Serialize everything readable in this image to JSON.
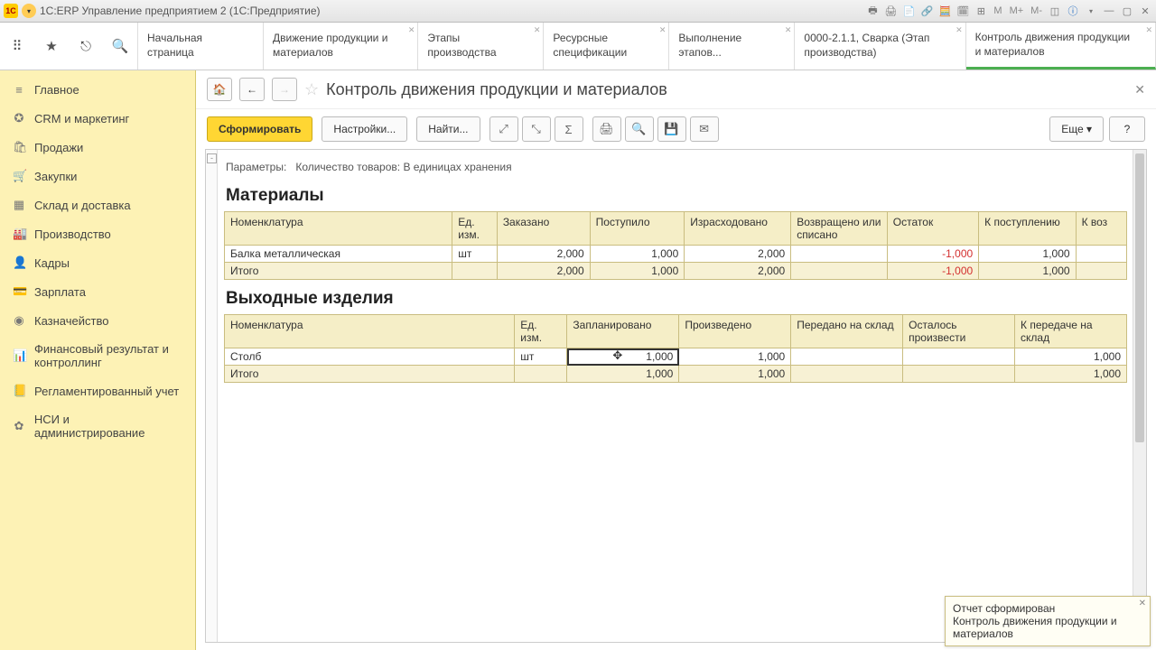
{
  "window": {
    "title": "1С:ERP Управление предприятием 2  (1С:Предприятие)"
  },
  "title_icons_text": [
    "M",
    "M+",
    "M-"
  ],
  "tabs": [
    {
      "label": "Начальная страница",
      "closable": false
    },
    {
      "label": "Движение продукции и материалов",
      "closable": true
    },
    {
      "label": "Этапы производства",
      "closable": true
    },
    {
      "label": "Ресурсные спецификации",
      "closable": true
    },
    {
      "label": "Выполнение этапов...",
      "closable": true
    },
    {
      "label": "0000-2.1.1, Сварка (Этап производства)",
      "closable": true
    },
    {
      "label": "Контроль движения продукции и материалов",
      "closable": true,
      "active": true
    }
  ],
  "sidebar": [
    {
      "icon": "≡",
      "label": "Главное"
    },
    {
      "icon": "✪",
      "label": "CRM и маркетинг"
    },
    {
      "icon": "🛍",
      "label": "Продажи"
    },
    {
      "icon": "🛒",
      "label": "Закупки"
    },
    {
      "icon": "▦",
      "label": "Склад и доставка"
    },
    {
      "icon": "🏭",
      "label": "Производство"
    },
    {
      "icon": "👤",
      "label": "Кадры"
    },
    {
      "icon": "💳",
      "label": "Зарплата"
    },
    {
      "icon": "◉",
      "label": "Казначейство"
    },
    {
      "icon": "📊",
      "label": "Финансовый результат и контроллинг"
    },
    {
      "icon": "📒",
      "label": "Регламентированный учет"
    },
    {
      "icon": "✿",
      "label": "НСИ и администрирование"
    }
  ],
  "page": {
    "title": "Контроль движения продукции и материалов",
    "form_btn": "Сформировать",
    "settings_btn": "Настройки...",
    "find_btn": "Найти...",
    "more_btn": "Еще",
    "help_btn": "?",
    "params_label": "Параметры:",
    "params_value": "Количество товаров: В единицах хранения"
  },
  "materials": {
    "title": "Материалы",
    "headers": [
      "Номенклатура",
      "Ед. изм.",
      "Заказано",
      "Поступило",
      "Израсходовано",
      "Возвращено или списано",
      "Остаток",
      "К поступлению",
      "К воз"
    ],
    "rows": [
      {
        "name": "Балка металлическая",
        "uom": "шт",
        "ordered": "2,000",
        "received": "1,000",
        "used": "2,000",
        "returned": "",
        "balance": "-1,000",
        "to_receive": "1,000",
        "to_return": ""
      }
    ],
    "total_label": "Итого",
    "total": {
      "ordered": "2,000",
      "received": "1,000",
      "used": "2,000",
      "returned": "",
      "balance": "-1,000",
      "to_receive": "1,000",
      "to_return": ""
    }
  },
  "products": {
    "title": "Выходные изделия",
    "headers": [
      "Номенклатура",
      "Ед. изм.",
      "Запланировано",
      "Произведено",
      "Передано на склад",
      "Осталось произвести",
      "К передаче на склад"
    ],
    "rows": [
      {
        "name": "Столб",
        "uom": "шт",
        "planned": "1,000",
        "produced": "1,000",
        "transferred": "",
        "remaining": "",
        "to_transfer": "1,000"
      }
    ],
    "total_label": "Итого",
    "total": {
      "planned": "1,000",
      "produced": "1,000",
      "transferred": "",
      "remaining": "",
      "to_transfer": "1,000"
    }
  },
  "toast": {
    "title": "Отчет сформирован",
    "body": "Контроль движения продукции и материалов"
  }
}
